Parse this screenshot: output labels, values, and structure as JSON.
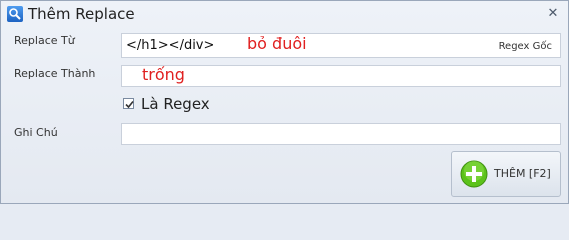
{
  "window": {
    "title": "Thêm Replace",
    "close_glyph": "✕"
  },
  "form": {
    "replace_from_label": "Replace Từ",
    "replace_from_value": "</h1></div>",
    "regex_source_label": "Regex Gốc",
    "replace_to_label": "Replace Thành",
    "replace_to_value": "",
    "is_regex_label": "Là Regex",
    "is_regex_checked": true,
    "note_label": "Ghi Chú",
    "note_value": ""
  },
  "annotations": {
    "replace_from_note": "bỏ đuôi",
    "replace_to_note": "trống"
  },
  "actions": {
    "add_label": "THÊM [F2]"
  },
  "colors": {
    "annotation": "#e02020",
    "add_icon": "#5cc21a"
  }
}
